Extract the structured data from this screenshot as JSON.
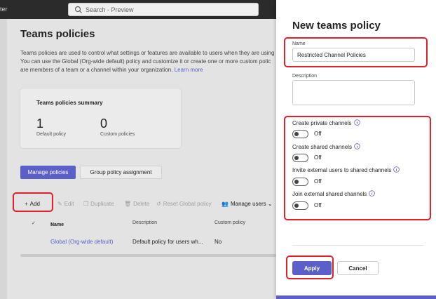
{
  "topbar": {
    "app_name": "ter",
    "search_placeholder": "Search - Preview"
  },
  "page": {
    "title": "Teams policies",
    "description_lines": [
      "Teams policies are used to control what settings or features are available to users when they are using",
      "You can use the Global (Org-wide default) policy and customize it or create one or more custom polic",
      "are members of a team or a channel within your organization."
    ],
    "learn_more": "Learn more",
    "summary": {
      "title": "Teams policies summary",
      "default_count": "1",
      "default_label": "Default policy",
      "custom_count": "0",
      "custom_label": "Custom policies"
    },
    "tabs": [
      {
        "label": "Manage policies",
        "active": true
      },
      {
        "label": "Group policy assignment",
        "active": false
      }
    ],
    "toolbar": {
      "add": "Add",
      "edit": "Edit",
      "duplicate": "Duplicate",
      "delete": "Delete",
      "reset": "Reset Global policy",
      "manage_users": "Manage users"
    },
    "table": {
      "headers": {
        "name": "Name",
        "description": "Description",
        "custom": "Custom policy"
      },
      "rows": [
        {
          "name": "Global (Org-wide default)",
          "description": "Default policy for users wh...",
          "custom": "No"
        }
      ]
    }
  },
  "panel": {
    "title": "New teams policy",
    "name_label": "Name",
    "name_value": "Restricted Channel Policies",
    "description_label": "Description",
    "toggles": [
      {
        "label": "Create private channels",
        "state": "Off"
      },
      {
        "label": "Create shared channels",
        "state": "Off"
      },
      {
        "label": "Invite external users to shared channels",
        "state": "Off"
      },
      {
        "label": "Join external shared channels",
        "state": "Off"
      }
    ],
    "apply": "Apply",
    "cancel": "Cancel"
  },
  "colors": {
    "accent": "#5b5fc7",
    "highlight": "#e0202a",
    "topbar": "#2b2b2b"
  },
  "icons": [
    "search-icon",
    "add-icon",
    "edit-icon",
    "duplicate-icon",
    "delete-icon",
    "reset-icon",
    "manage-users-icon",
    "chevron-down-icon",
    "sort-icon",
    "check-icon",
    "info-icon"
  ]
}
